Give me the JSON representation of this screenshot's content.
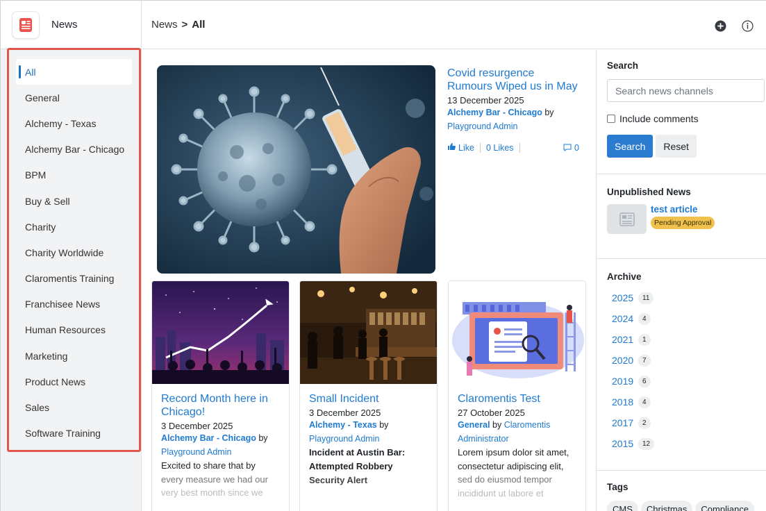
{
  "app": {
    "title": "News"
  },
  "breadcrumb": {
    "root": "News",
    "separator": ">",
    "current": "All"
  },
  "sidebar": {
    "items": [
      {
        "label": "All",
        "active": true
      },
      {
        "label": "General"
      },
      {
        "label": "Alchemy - Texas"
      },
      {
        "label": "Alchemy Bar - Chicago"
      },
      {
        "label": "BPM"
      },
      {
        "label": "Buy & Sell"
      },
      {
        "label": "Charity"
      },
      {
        "label": "Charity Worldwide"
      },
      {
        "label": "Claromentis Training"
      },
      {
        "label": "Franchisee News"
      },
      {
        "label": "Human Resources"
      },
      {
        "label": "Marketing"
      },
      {
        "label": "Product News"
      },
      {
        "label": "Sales"
      },
      {
        "label": "Software Training"
      }
    ]
  },
  "featured": {
    "title": "Covid resurgence Rumours Wiped us in May",
    "date": "13 December 2025",
    "channel": "Alchemy Bar - Chicago",
    "by": "by",
    "author": "Playground Admin",
    "like_label": "Like",
    "likes": "0 Likes",
    "comments": "0"
  },
  "cards": [
    {
      "title": "Record Month here in Chicago!",
      "date": "3 December 2025",
      "channel": "Alchemy Bar - Chicago",
      "by": "by",
      "author": "Playground Admin",
      "excerpt_1": "Excited to share that by",
      "excerpt_2": "every measure we had our",
      "excerpt_3": "very best month since we"
    },
    {
      "title": "Small Incident",
      "date": "3 December 2025",
      "channel": "Alchemy - Texas",
      "by": "by",
      "author": "Playground Admin",
      "excerpt_1": "Incident at Austin Bar:",
      "excerpt_2": "Attempted Robbery",
      "excerpt_3": "Security Alert"
    },
    {
      "title": "Claromentis Test",
      "date": "27 October 2025",
      "channel": "General",
      "by": "by",
      "author": "Claromentis Administrator",
      "excerpt_1": "Lorem ipsum dolor sit amet,",
      "excerpt_2": "consectetur adipiscing elit,",
      "excerpt_3": "sed do eiusmod tempor",
      "excerpt_4": "incididunt ut labore et"
    }
  ],
  "search": {
    "title": "Search",
    "placeholder": "Search news channels",
    "include_comments": "Include comments",
    "search_button": "Search",
    "reset_button": "Reset"
  },
  "unpublished": {
    "title": "Unpublished News",
    "item_title": "test article",
    "status": "Pending Approval"
  },
  "archive": {
    "title": "Archive",
    "years": [
      {
        "year": "2025",
        "count": "11"
      },
      {
        "year": "2024",
        "count": "4"
      },
      {
        "year": "2021",
        "count": "1"
      },
      {
        "year": "2020",
        "count": "7"
      },
      {
        "year": "2019",
        "count": "6"
      },
      {
        "year": "2018",
        "count": "4"
      },
      {
        "year": "2017",
        "count": "2"
      },
      {
        "year": "2015",
        "count": "12"
      }
    ]
  },
  "tags": {
    "title": "Tags",
    "items": [
      "CMS",
      "Christmas",
      "Compliance"
    ]
  },
  "colors": {
    "accent": "#1f7ad0",
    "primary_button": "#2b7bd0",
    "highlight_border": "#e2574c",
    "pending_badge": "#f0c14d"
  }
}
